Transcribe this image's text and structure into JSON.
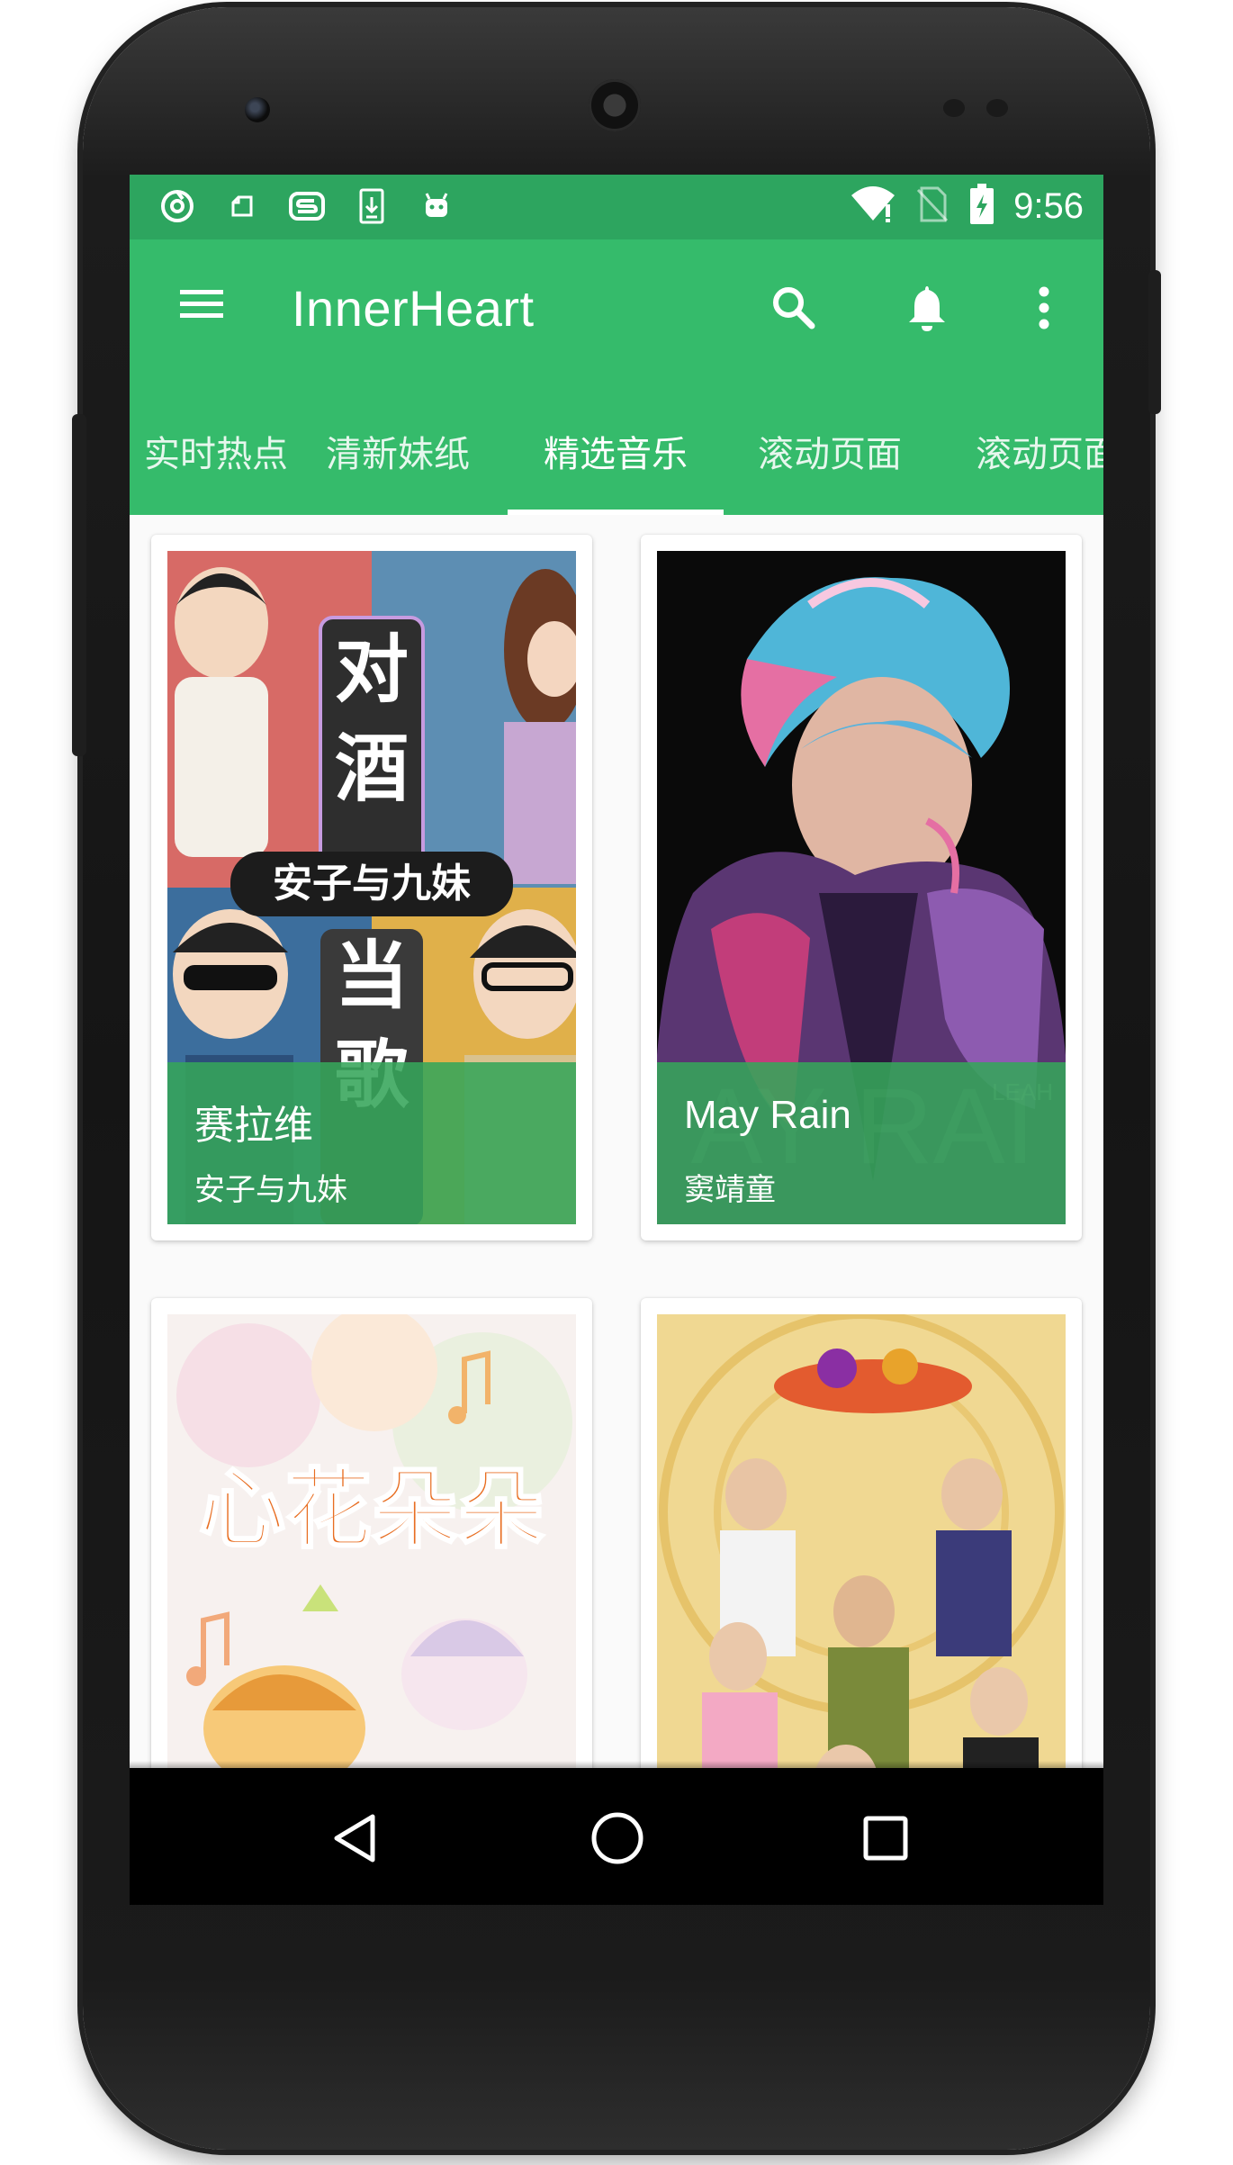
{
  "status_bar": {
    "left_icons": [
      "netease-music-icon",
      "clipboard-icon",
      "s-app-icon",
      "download-icon",
      "android-icon"
    ],
    "right_icons": [
      "wifi-icon",
      "no-sim-icon",
      "battery-charging-icon"
    ],
    "time": "9:56"
  },
  "app_bar": {
    "title": "InnerHeart",
    "actions": [
      "menu-icon",
      "search-icon",
      "bell-icon",
      "more-icon"
    ]
  },
  "tabs": {
    "items": [
      {
        "label": "实时热点"
      },
      {
        "label": "清新妹纸"
      },
      {
        "label": "精选音乐"
      },
      {
        "label": "滚动页面"
      },
      {
        "label": "滚动页面"
      }
    ],
    "active_index": 2
  },
  "cards": [
    {
      "title": "赛拉维",
      "subtitle": "安子与九妹",
      "art_text": [
        "对",
        "酒",
        "安子与九妹",
        "当",
        "歌"
      ]
    },
    {
      "title": "May Rain",
      "subtitle": "窦靖童"
    },
    {
      "title": "",
      "subtitle": "",
      "art_text": [
        "心花朵朵"
      ]
    },
    {
      "title": "",
      "subtitle": ""
    }
  ],
  "nav_bar": {
    "buttons": [
      "back-icon",
      "home-icon",
      "recents-icon"
    ]
  },
  "colors": {
    "status_bar": "#2da55f",
    "primary": "#35bb6b",
    "caption_overlay": "#35a55a",
    "nav_bar": "#000000"
  }
}
